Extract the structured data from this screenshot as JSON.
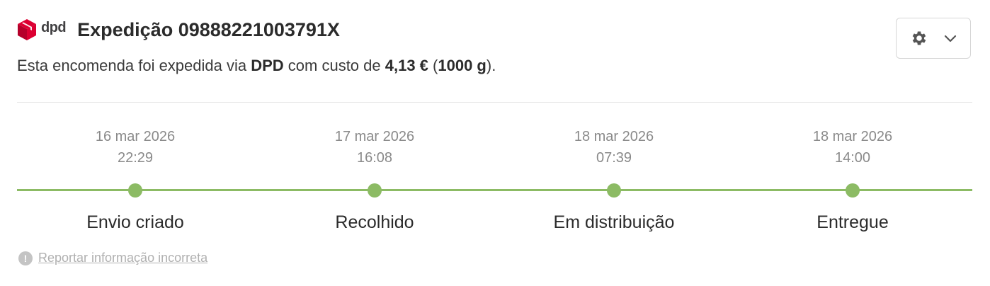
{
  "brand": {
    "logo_text": "dpd",
    "colors": {
      "logo_red": "#dc0032",
      "accent_green": "#8cbb64"
    }
  },
  "header": {
    "title": "Expedição 09888221003791X"
  },
  "summary": {
    "prefix": "Esta encomenda foi expedida via ",
    "carrier": "DPD",
    "middle": " com custo de ",
    "cost": "4,13 €",
    "open_paren": " (",
    "weight": "1000 g",
    "suffix": ")."
  },
  "settings": {
    "icon": "gear-icon",
    "dropdown_icon": "chevron-down-icon"
  },
  "timeline": {
    "steps": [
      {
        "date": "16 mar 2026",
        "time": "22:29",
        "label": "Envio criado"
      },
      {
        "date": "17 mar 2026",
        "time": "16:08",
        "label": "Recolhido"
      },
      {
        "date": "18 mar 2026",
        "time": "07:39",
        "label": "Em distribuição"
      },
      {
        "date": "18 mar 2026",
        "time": "14:00",
        "label": "Entregue"
      }
    ]
  },
  "report": {
    "icon": "exclamation-icon",
    "text": " Reportar informação incorreta"
  }
}
